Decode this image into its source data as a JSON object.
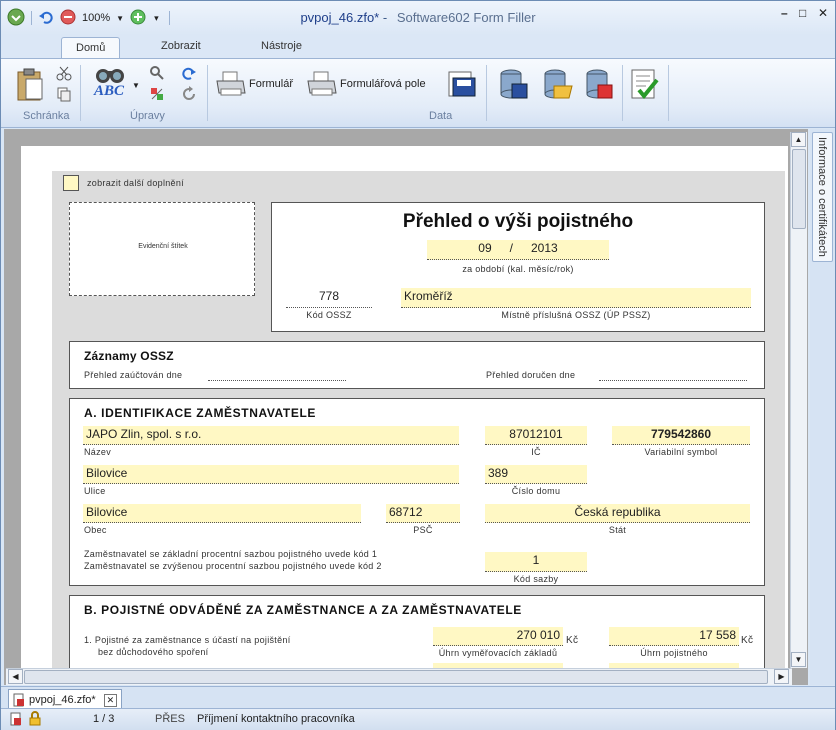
{
  "window": {
    "zoom": "100%",
    "file_name": "pvpoj_46.zfo*",
    "title_sep": "-",
    "app_name": "Software602 Form Filler",
    "min": "–",
    "max": "□",
    "close": "✕"
  },
  "tabs": [
    {
      "label": "Domů",
      "active": true
    },
    {
      "label": "Zobrazit",
      "active": false
    },
    {
      "label": "Nástroje",
      "active": false
    }
  ],
  "ribbon": {
    "groups": {
      "clipboard": "Schránka",
      "edit": "Úpravy",
      "data": "Data"
    },
    "form_button": "Formulář",
    "form_fields_button": "Formulářová pole",
    "spell_label": "ABC"
  },
  "form": {
    "show_more_checkbox": "zobrazit další doplnění",
    "stamp_box": "Evidenční štítek",
    "title": "Přehled o výši pojistného",
    "period_month": "09",
    "period_sep": "/",
    "period_year": "2013",
    "period_label": "za období (kal. měsíc/rok)",
    "ossz_code": "778",
    "ossz_code_label": "Kód OSSZ",
    "ossz_place": "Kroměříž",
    "ossz_place_label": "Místně příslušná OSSZ (ÚP PSSZ)",
    "records": {
      "title": "Záznamy OSSZ",
      "booked_label": "Přehled zaúčtován dne",
      "delivered_label": "Přehled doručen dne"
    },
    "sectionA": {
      "title": "A. IDENTIFIKACE ZAMĚSTNAVATELE",
      "name": "JAPO Zlin, spol. s r.o.",
      "name_label": "Název",
      "ico": "87012101",
      "ico_label": "IČ",
      "varsym": "779542860",
      "varsym_label": "Variabilní symbol",
      "street": "Bilovice",
      "street_label": "Ulice",
      "house_no": "389",
      "house_no_label": "Číslo domu",
      "city": "Bilovice",
      "city_label": "Obec",
      "zip": "68712",
      "zip_label": "PSČ",
      "state": "Česká republika",
      "state_label": "Stát",
      "rate_note_1": "Zaměstnavatel se základní procentní sazbou pojistného uvede kód 1",
      "rate_note_2": "Zaměstnavatel se zvýšenou procentní sazbou pojistného uvede kód 2",
      "rate_code": "1",
      "rate_code_label": "Kód sazby"
    },
    "sectionB": {
      "title": "B. POJISTNÉ ODVÁDĚNÉ ZA ZAMĚSTNANCE A ZA ZAMĚSTNAVATELE",
      "row1_line1": "1. Pojistné za zaměstnance s účastí na pojištění",
      "row1_line2": "bez důchodového spoření",
      "base_value": "270 010",
      "base_currency": "Kč",
      "base_label": "Úhrn vyměřovacích základů",
      "premium_value": "17 558",
      "premium_currency": "Kč",
      "premium_label": "Úhrn pojistného"
    }
  },
  "side_panel": {
    "label": "Informace o certifikátech"
  },
  "doc_tab": {
    "label": "pvpoj_46.zfo*",
    "close": "✕"
  },
  "status": {
    "page": "1 / 3",
    "mode": "PŘES",
    "field": "Příjmení kontaktního pracovníka"
  }
}
